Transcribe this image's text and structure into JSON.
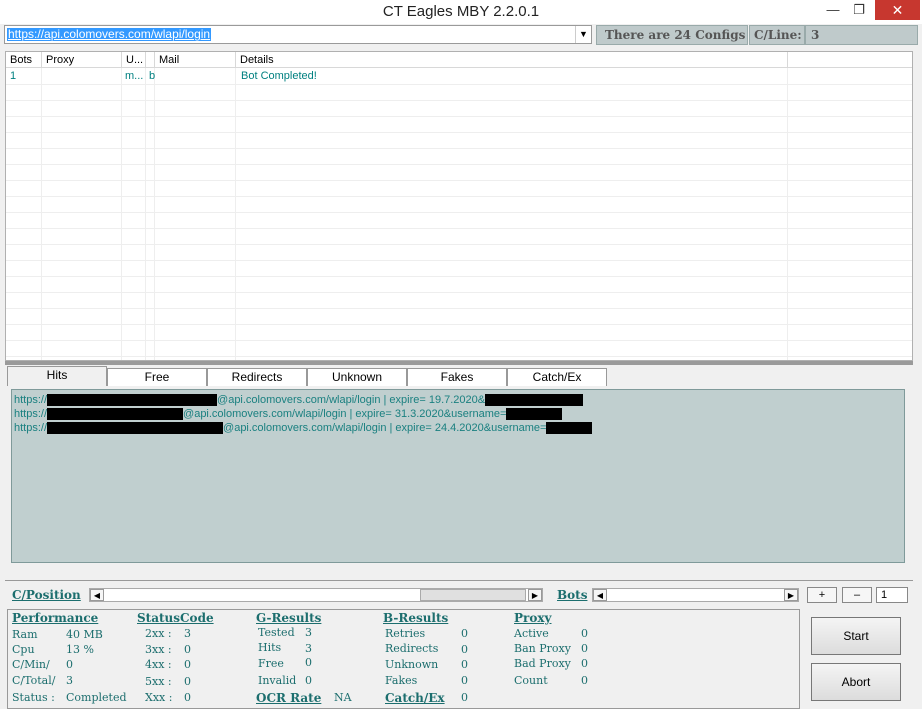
{
  "window": {
    "title": "CT Eagles MBY 2.2.0.1",
    "min_glyph": "—",
    "max_glyph": "❐",
    "close_glyph": "✕"
  },
  "url": {
    "value": "https://api.colomovers.com/wlapi/login",
    "dropdown_glyph": "▼"
  },
  "configs_text": "There are 24 Configs",
  "cline": {
    "label": "C/Line:",
    "value": "3"
  },
  "grid": {
    "headers": [
      "Bots",
      "Proxy",
      "U...",
      "",
      "Mail",
      "Details"
    ],
    "rows": [
      {
        "bots": "1",
        "proxy": "",
        "u": "m...",
        "x": "b",
        "mail": "",
        "details": "Bot Completed!"
      }
    ]
  },
  "tabs": [
    "Hits",
    "Free",
    "Redirects",
    "Unknown",
    "Fakes",
    "Catch/Ex"
  ],
  "hits": [
    {
      "prefix": "https://",
      "middle": "@api.colomovers.com/wlapi/login | expire= 19.7.2020&"
    },
    {
      "prefix": "https://",
      "middle": "@api.colomovers.com/wlapi/login | expire= 31.3.2020&username="
    },
    {
      "prefix": "https://",
      "middle": "@api.colomovers.com/wlapi/login | expire= 24.4.2020&username="
    }
  ],
  "lower": {
    "cposition": "C/Position",
    "bots": "Bots",
    "plus": "+",
    "minus": "–",
    "bots_count": "1",
    "scroll_left": "◀",
    "scroll_right": "▶"
  },
  "performance": {
    "title": "Performance",
    "ram_label": "Ram",
    "ram_value": "40 MB",
    "cpu_label": "Cpu",
    "cpu_value": "13 %",
    "cmin_label": "C/Min/",
    "cmin_value": "0",
    "ctotal_label": "C/Total/",
    "ctotal_value": "3",
    "status_label": "Status :",
    "status_value": "Completed"
  },
  "statuscode": {
    "title": "StatusCode",
    "items": [
      {
        "label": "2xx :",
        "value": "3"
      },
      {
        "label": "3xx :",
        "value": "0"
      },
      {
        "label": "4xx :",
        "value": "0"
      },
      {
        "label": "5xx :",
        "value": "0"
      },
      {
        "label": "Xxx :",
        "value": "0"
      }
    ]
  },
  "gresults": {
    "title": "G-Results",
    "items": [
      {
        "label": "Tested",
        "value": "3"
      },
      {
        "label": "Hits",
        "value": "3"
      },
      {
        "label": "Free",
        "value": "0"
      },
      {
        "label": "Invalid",
        "value": "0"
      }
    ],
    "ocr_label": "OCR Rate",
    "ocr_value": "NA"
  },
  "bresults": {
    "title": "B-Results",
    "items": [
      {
        "label": "Retries",
        "value": "0"
      },
      {
        "label": "Redirects",
        "value": "0"
      },
      {
        "label": "Unknown",
        "value": "0"
      },
      {
        "label": "Fakes",
        "value": "0"
      }
    ],
    "catch_label": "Catch/Ex",
    "catch_value": "0"
  },
  "proxy": {
    "title": "Proxy",
    "items": [
      {
        "label": "Active",
        "value": "0"
      },
      {
        "label": "Ban Proxy",
        "value": "0"
      },
      {
        "label": "Bad Proxy",
        "value": "0"
      },
      {
        "label": "Count",
        "value": "0"
      }
    ]
  },
  "buttons": {
    "start": "Start",
    "abort": "Abort"
  }
}
